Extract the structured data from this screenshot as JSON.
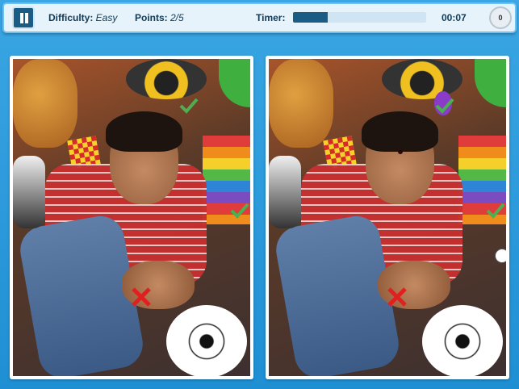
{
  "header": {
    "difficulty_label": "Difficulty: ",
    "difficulty_value": "Easy",
    "points_label": "Points: ",
    "points_value": "2/5",
    "timer_label": "Timer:",
    "timer_value": "00:07",
    "timer_progress": 0.26,
    "hint_count": "0"
  },
  "colors": {
    "accent": "#1a5c84",
    "check": "#4caf50",
    "cross": "#e02020",
    "background": "#2a9be0"
  },
  "game": {
    "panels": [
      "left-photo",
      "right-photo"
    ],
    "found_marks": "check-icon",
    "wrong_marks": "cross-icon"
  }
}
